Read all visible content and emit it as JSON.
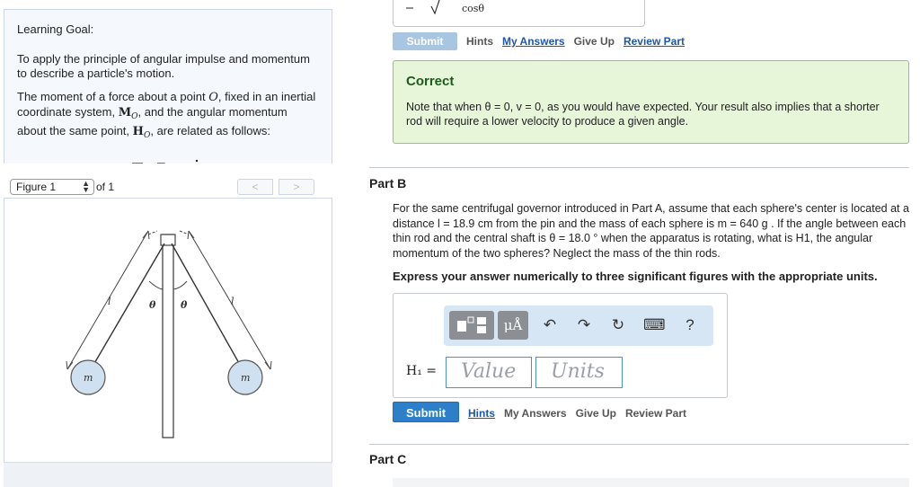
{
  "learning_goal": {
    "title": "Learning Goal:",
    "p1": "To apply the principle of angular impulse and momentum to describe a particle's motion.",
    "p2_a": "The moment of a force about a point ",
    "p2_point": "O",
    "p2_b": ", fixed in an inertial coordinate system, ",
    "p2_M": "M",
    "p2_c": ", and the angular momentum about the same point, ",
    "p2_H": "H",
    "p2_d": ", are related as follows:",
    "sub_O": "O"
  },
  "figure": {
    "select_label": "Figure 1",
    "of_label": "of 1",
    "prev": "<",
    "next": ">",
    "label_l": "l",
    "label_theta": "θ",
    "label_m": "m"
  },
  "part_a": {
    "formula_fragment": "cosθ",
    "submit": "Submit",
    "hints": "Hints",
    "my_answers": "My Answers",
    "give_up": "Give Up",
    "review_part": "Review Part",
    "correct_title": "Correct",
    "correct_text": "Note that when θ = 0, v = 0, as you would have expected. Your result also implies that a shorter rod will require a lower velocity to produce a given angle."
  },
  "part_b": {
    "label": "Part B",
    "text": "For the same centrifugal governor introduced in Part A, assume that each sphere's center is located at a distance l = 18.9 cm from the pin and the mass of each sphere is m = 640 g . If the angle between each thin rod and the central shaft is θ = 18.0 ° when the apparatus is rotating, what is H1, the angular momentum of the two spheres? Neglect the mass of the thin rods.",
    "instruction": "Express your answer numerically to three significant figures with the appropriate units.",
    "toolbar_unit": "μÅ",
    "undo": "↶",
    "redo": "↷",
    "reset": "↻",
    "keyboard": "⌨",
    "help": "?",
    "h_label": "H₁ =",
    "value_placeholder": "Value",
    "units_placeholder": "Units",
    "submit": "Submit",
    "hints": "Hints",
    "my_answers": "My Answers",
    "give_up": "Give Up",
    "review_part": "Review Part"
  },
  "part_c": {
    "label": "Part C"
  },
  "colors": {
    "submit_active": "#2d7fc9",
    "submit_disabled": "#a8c6e2",
    "correct_bg": "#e7f5d9",
    "correct_border": "#8fc96b",
    "link": "#1d57a8"
  }
}
